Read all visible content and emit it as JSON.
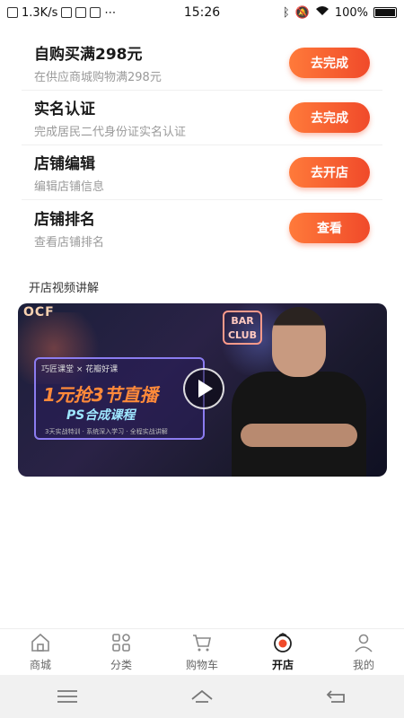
{
  "status_bar": {
    "speed": "1.3K/s",
    "time": "15:26",
    "battery": "100%",
    "icons": [
      "close-box-icon",
      "mail-icon",
      "message-icon",
      "check-icon",
      "more-icon",
      "bluetooth-icon",
      "mute-icon",
      "wifi-icon",
      "battery-icon"
    ]
  },
  "tasks": [
    {
      "title": "自购买满298元",
      "subtitle": "在供应商城购物满298元",
      "button": "去完成"
    },
    {
      "title": "实名认证",
      "subtitle": "完成居民二代身份证实名认证",
      "button": "去完成"
    },
    {
      "title": "店铺编辑",
      "subtitle": "编辑店铺信息",
      "button": "去开店"
    },
    {
      "title": "店铺排名",
      "subtitle": "查看店铺排名",
      "button": "查看"
    }
  ],
  "video_section": {
    "title": "开店视频讲解",
    "neon_left": "OCF",
    "neon_right": "BAR CLUB",
    "promo_top": "巧匠课堂 × 花瓣好课",
    "promo_main": "1元抢3节直播",
    "promo_sub": "PS合成课程",
    "promo_foot": "3天实战特训 · 系统深入学习 · 全程实战讲解"
  },
  "tab_bar": {
    "tabs": [
      {
        "label": "商城",
        "icon": "home-icon",
        "active": false
      },
      {
        "label": "分类",
        "icon": "grid-icon",
        "active": false
      },
      {
        "label": "购物车",
        "icon": "cart-icon",
        "active": false
      },
      {
        "label": "开店",
        "icon": "shop-icon",
        "active": true
      },
      {
        "label": "我的",
        "icon": "user-icon",
        "active": false
      }
    ]
  },
  "colors": {
    "accent_gradient_start": "#ff7a3a",
    "accent_gradient_end": "#f04a2a",
    "active_tab_icon": "#f04a2a"
  }
}
